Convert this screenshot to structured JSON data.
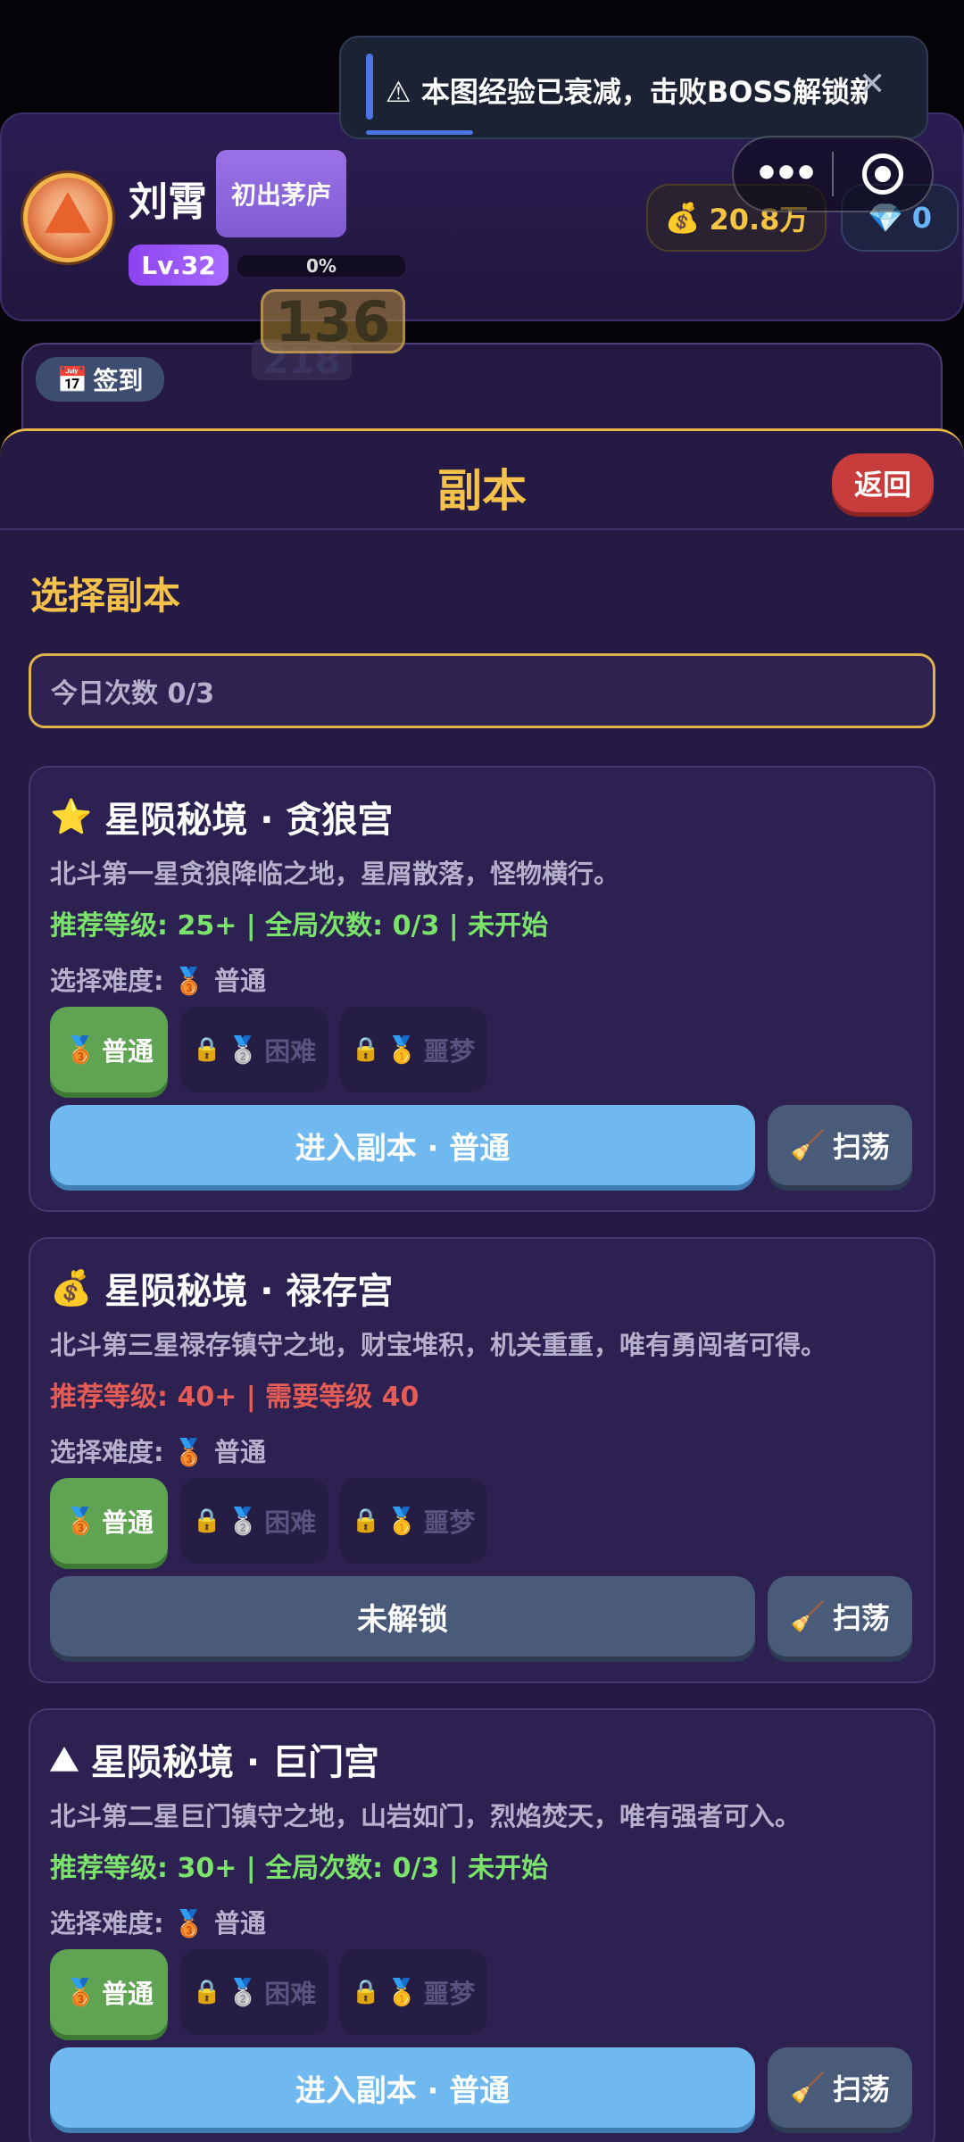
{
  "toast": {
    "icon": "⚠",
    "message": "本图经验已衰减，击败BOSS解锁新地图",
    "close": "✕"
  },
  "player": {
    "name": "刘霄",
    "title": "初出茅庐",
    "level": "Lv.32",
    "exp_percent": "0%",
    "gold_icon": "💰",
    "gold": "20.8万",
    "gem_icon": "💎",
    "gems": "0"
  },
  "floating": {
    "num1": "136",
    "num2": "218"
  },
  "signin": {
    "icon": "📅",
    "label": "签到"
  },
  "panel": {
    "title": "副本",
    "back_label": "返回",
    "section_title": "选择副本",
    "daily_count": "今日次数 0/3"
  },
  "dungeons": [
    {
      "icon": "⭐",
      "name": "星陨秘境 · 贪狼宫",
      "description": "北斗第一星贪狼降临之地，星屑散落，怪物横行。",
      "recommend": "推荐等级: 25+ | 全局次数: 0/3 | 未开始",
      "recommend_status": "ok",
      "difficulty_label": "选择难度:",
      "difficulty_selected": "普通",
      "difficulties": [
        "普通",
        "困难",
        "噩梦"
      ],
      "enter_label": "进入副本 · 普通",
      "sweep_label": "扫荡"
    },
    {
      "icon": "💰",
      "name": "星陨秘境 · 禄存宫",
      "description": "北斗第三星禄存镇守之地，财宝堆积，机关重重，唯有勇闯者可得。",
      "recommend": "推荐等级: 40+ | 需要等级 40",
      "recommend_status": "locked",
      "difficulty_label": "选择难度:",
      "difficulty_selected": "普通",
      "difficulties": [
        "普通",
        "困难",
        "噩梦"
      ],
      "enter_label": "未解锁",
      "sweep_label": "扫荡"
    },
    {
      "icon": "⛰",
      "name": "星陨秘境 · 巨门宫",
      "description": "北斗第二星巨门镇守之地，山岩如门，烈焰焚天，唯有强者可入。",
      "recommend": "推荐等级: 30+ | 全局次数: 0/3 | 未开始",
      "recommend_status": "ok",
      "difficulty_label": "选择难度:",
      "difficulty_selected": "普通",
      "difficulties": [
        "普通",
        "困难",
        "噩梦"
      ],
      "enter_label": "进入副本 · 普通",
      "sweep_label": "扫荡"
    }
  ],
  "colors": {
    "accent_gold": "#f4c24a",
    "enter_blue": "#6fb9f0",
    "normal_green": "#5fa452",
    "back_red": "#c93c3c"
  }
}
